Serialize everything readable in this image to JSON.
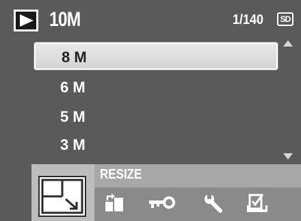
{
  "header": {
    "mode_icon": "playback-icon",
    "resolution": "10M",
    "counter": "1/140",
    "card_badge": "SD"
  },
  "menu": {
    "items": [
      {
        "label": "8 M",
        "selected": true
      },
      {
        "label": "6 M",
        "selected": false
      },
      {
        "label": "5 M",
        "selected": false
      },
      {
        "label": "3 M",
        "selected": false
      }
    ],
    "scroll_up_icon": "scroll-up-arrow-icon",
    "scroll_down_icon": "scroll-down-arrow-icon"
  },
  "feature": {
    "label": "RESIZE",
    "icon": "resize-icon"
  },
  "toolbar": {
    "icons": [
      "rotate-icon",
      "protect-key-icon",
      "settings-wrench-icon",
      "print-order-icon"
    ]
  },
  "colors": {
    "background": "#5a5a5a",
    "selection": "#dcdcdc",
    "label_bar": "#a8a8a8",
    "tool_strip": "#8a8a8a"
  }
}
